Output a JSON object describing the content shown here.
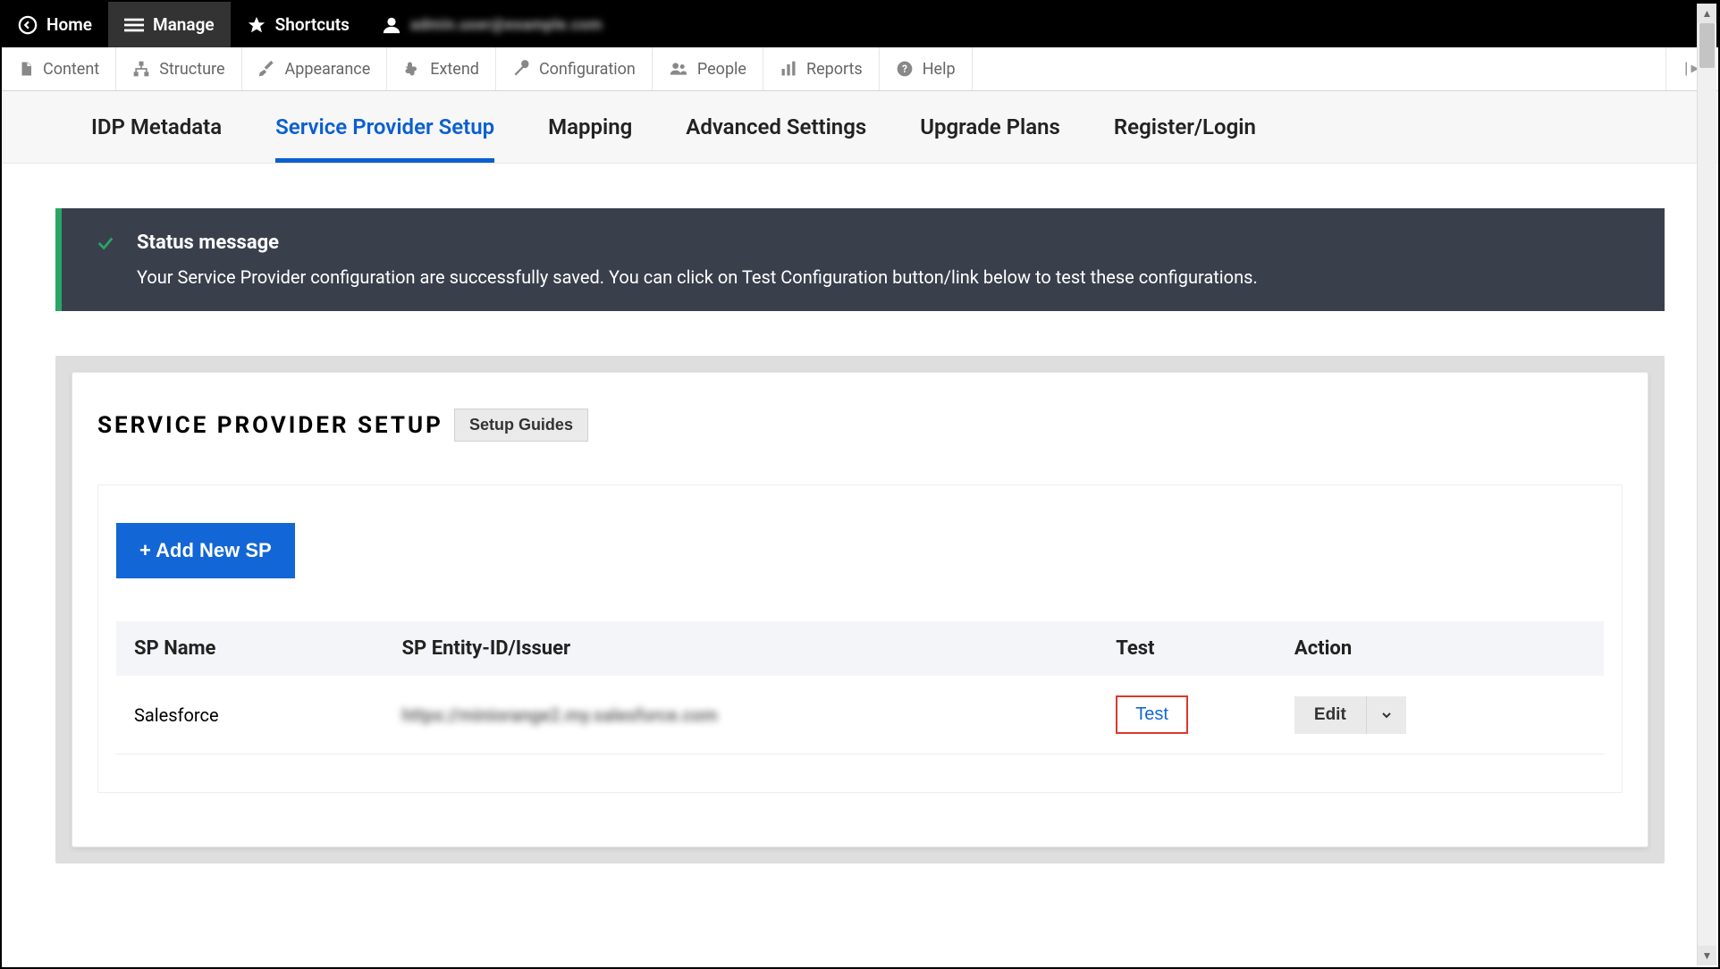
{
  "topbar": {
    "home": "Home",
    "manage": "Manage",
    "shortcuts": "Shortcuts",
    "user_label": "admin.user@example.com"
  },
  "admin_toolbar": {
    "content": "Content",
    "structure": "Structure",
    "appearance": "Appearance",
    "extend": "Extend",
    "configuration": "Configuration",
    "people": "People",
    "reports": "Reports",
    "help": "Help"
  },
  "module_tabs": [
    {
      "id": "idp-metadata",
      "label": "IDP Metadata"
    },
    {
      "id": "sp-setup",
      "label": "Service Provider Setup"
    },
    {
      "id": "mapping",
      "label": "Mapping"
    },
    {
      "id": "advanced",
      "label": "Advanced Settings"
    },
    {
      "id": "upgrade",
      "label": "Upgrade Plans"
    },
    {
      "id": "register",
      "label": "Register/Login"
    }
  ],
  "active_tab": "sp-setup",
  "status": {
    "title": "Status message",
    "body": "Your Service Provider configuration are successfully saved. You can click on Test Configuration button/link below to test these configurations."
  },
  "panel": {
    "title": "SERVICE PROVIDER SETUP",
    "setup_guides_label": "Setup Guides",
    "add_sp_label": "+ Add New SP"
  },
  "table": {
    "headers": {
      "name": "SP Name",
      "entity": "SP Entity-ID/Issuer",
      "test": "Test",
      "action": "Action"
    },
    "rows": [
      {
        "name": "Salesforce",
        "entity": "https://miniorange2.my.salesforce.com",
        "test_label": "Test",
        "action_label": "Edit"
      }
    ]
  }
}
